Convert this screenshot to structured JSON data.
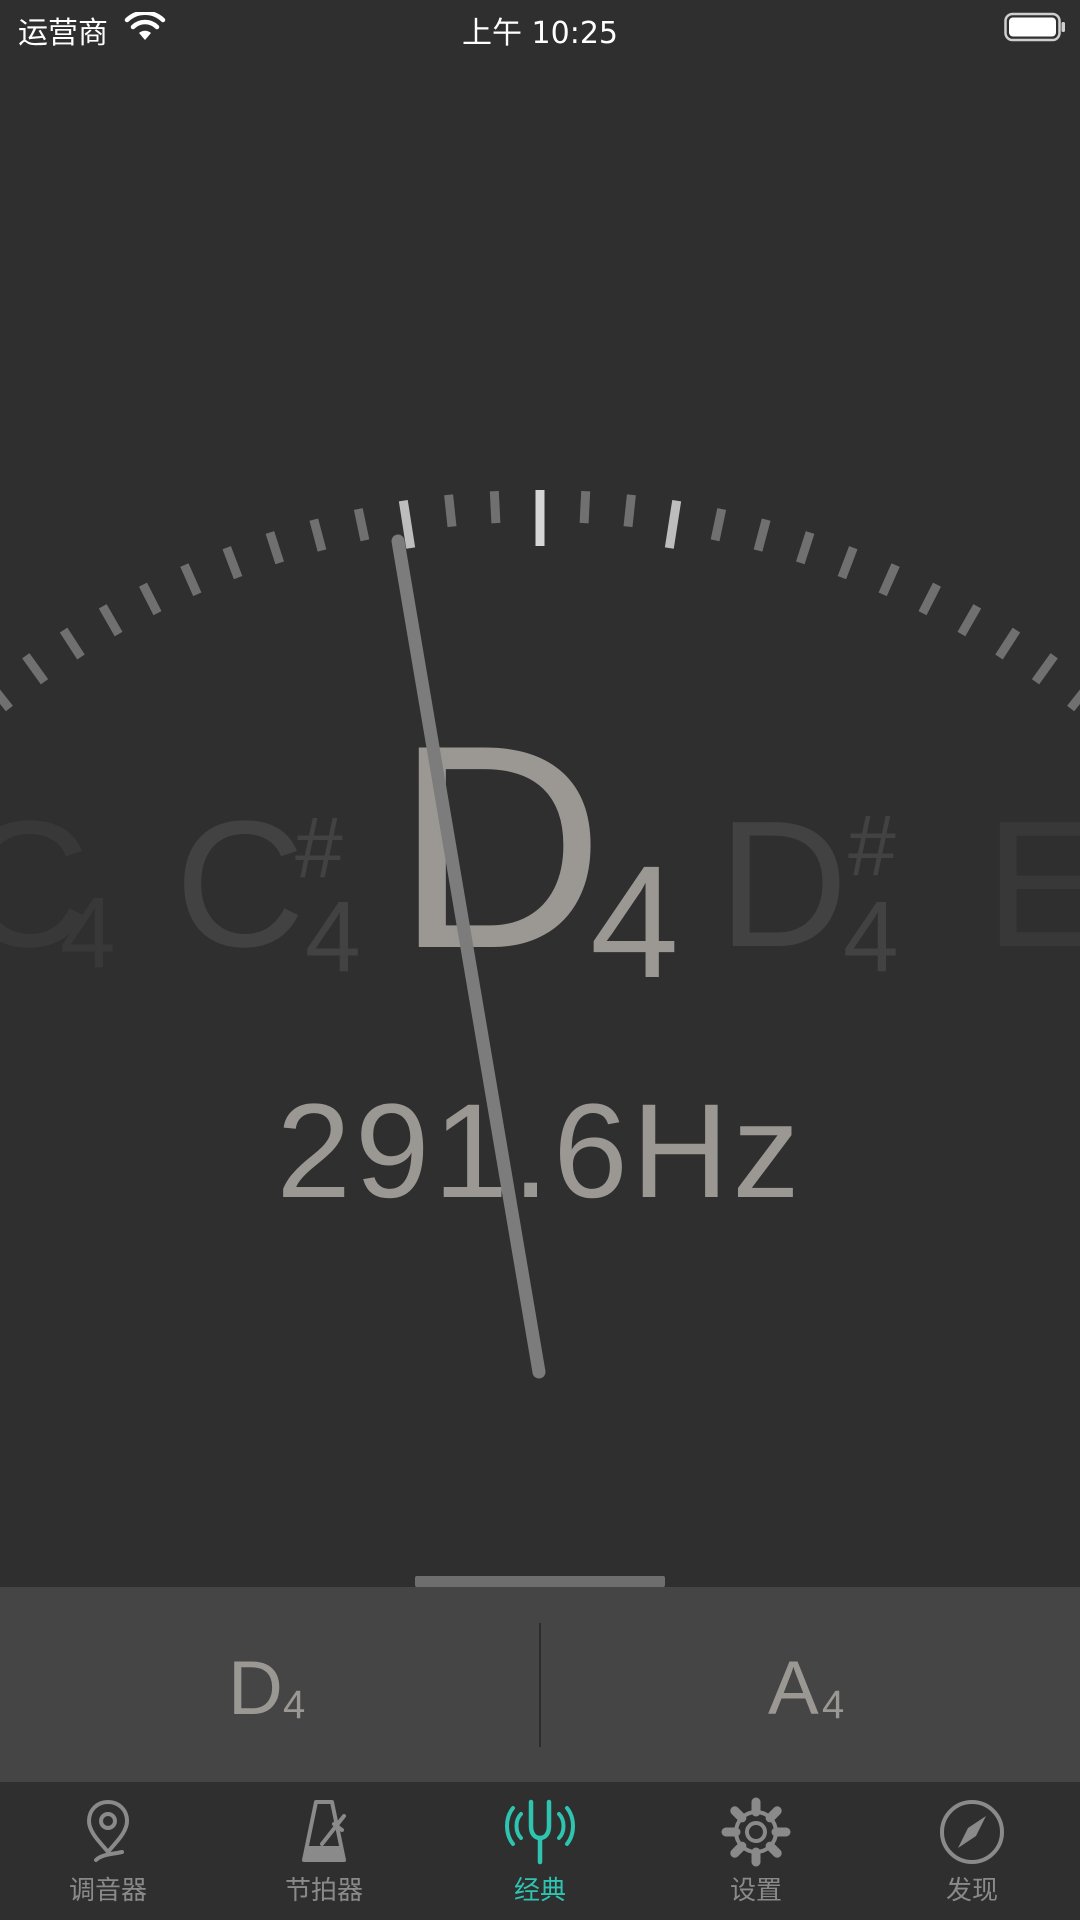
{
  "status_bar": {
    "carrier": "运营商",
    "time": "上午 10:25"
  },
  "tuner": {
    "main_note": {
      "letter": "D",
      "octave": "4"
    },
    "neighbors": [
      {
        "letter": "C",
        "sharp": "",
        "octave": "4"
      },
      {
        "letter": "C",
        "sharp": "#",
        "octave": "4"
      },
      {
        "letter": "D",
        "sharp": "#",
        "octave": "4"
      },
      {
        "letter": "E",
        "sharp": "",
        "octave": ""
      }
    ],
    "frequency": "291.6Hz"
  },
  "strings": [
    {
      "letter": "D",
      "octave": "4"
    },
    {
      "letter": "A",
      "octave": "4"
    }
  ],
  "tabs": [
    {
      "label": "调音器",
      "icon": "map-pin-icon",
      "active": false
    },
    {
      "label": "节拍器",
      "icon": "metronome-icon",
      "active": false
    },
    {
      "label": "经典",
      "icon": "tuning-fork-icon",
      "active": true
    },
    {
      "label": "设置",
      "icon": "gear-icon",
      "active": false
    },
    {
      "label": "发现",
      "icon": "compass-icon",
      "active": false
    }
  ],
  "colors": {
    "background": "#2f2f2f",
    "panel": "#454545",
    "accent": "#2ec4b0",
    "note_text": "#9b9894"
  }
}
